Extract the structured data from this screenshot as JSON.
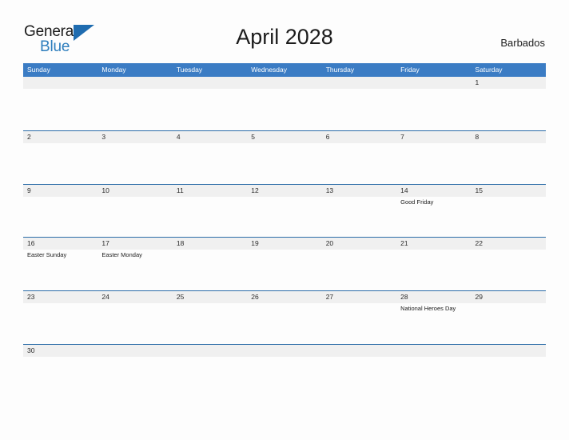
{
  "logo": {
    "word_one": "General",
    "word_two": "Blue",
    "triangle_icon": "triangle-right-icon",
    "dark_color": "#1a1a1a",
    "blue_color": "#2e7ebd"
  },
  "header": {
    "title": "April 2028",
    "country": "Barbados"
  },
  "colors": {
    "header_blue": "#3b7cc4",
    "divider_blue": "#2b6ca8",
    "date_band_gray": "#f0f0f0",
    "page_background": "#fdfdfd",
    "text_dark": "#1c1c1c"
  },
  "calendar": {
    "weekdays": [
      "Sunday",
      "Monday",
      "Tuesday",
      "Wednesday",
      "Thursday",
      "Friday",
      "Saturday"
    ],
    "weeks": [
      [
        {
          "date": "",
          "events": []
        },
        {
          "date": "",
          "events": []
        },
        {
          "date": "",
          "events": []
        },
        {
          "date": "",
          "events": []
        },
        {
          "date": "",
          "events": []
        },
        {
          "date": "",
          "events": []
        },
        {
          "date": "1",
          "events": []
        }
      ],
      [
        {
          "date": "2",
          "events": []
        },
        {
          "date": "3",
          "events": []
        },
        {
          "date": "4",
          "events": []
        },
        {
          "date": "5",
          "events": []
        },
        {
          "date": "6",
          "events": []
        },
        {
          "date": "7",
          "events": []
        },
        {
          "date": "8",
          "events": []
        }
      ],
      [
        {
          "date": "9",
          "events": []
        },
        {
          "date": "10",
          "events": []
        },
        {
          "date": "11",
          "events": []
        },
        {
          "date": "12",
          "events": []
        },
        {
          "date": "13",
          "events": []
        },
        {
          "date": "14",
          "events": [
            "Good Friday"
          ]
        },
        {
          "date": "15",
          "events": []
        }
      ],
      [
        {
          "date": "16",
          "events": [
            "Easter Sunday"
          ]
        },
        {
          "date": "17",
          "events": [
            "Easter Monday"
          ]
        },
        {
          "date": "18",
          "events": []
        },
        {
          "date": "19",
          "events": []
        },
        {
          "date": "20",
          "events": []
        },
        {
          "date": "21",
          "events": []
        },
        {
          "date": "22",
          "events": []
        }
      ],
      [
        {
          "date": "23",
          "events": []
        },
        {
          "date": "24",
          "events": []
        },
        {
          "date": "25",
          "events": []
        },
        {
          "date": "26",
          "events": []
        },
        {
          "date": "27",
          "events": []
        },
        {
          "date": "28",
          "events": [
            "National Heroes Day"
          ]
        },
        {
          "date": "29",
          "events": []
        }
      ],
      [
        {
          "date": "30",
          "events": []
        },
        {
          "date": "",
          "events": []
        },
        {
          "date": "",
          "events": []
        },
        {
          "date": "",
          "events": []
        },
        {
          "date": "",
          "events": []
        },
        {
          "date": "",
          "events": []
        },
        {
          "date": "",
          "events": []
        }
      ]
    ]
  }
}
